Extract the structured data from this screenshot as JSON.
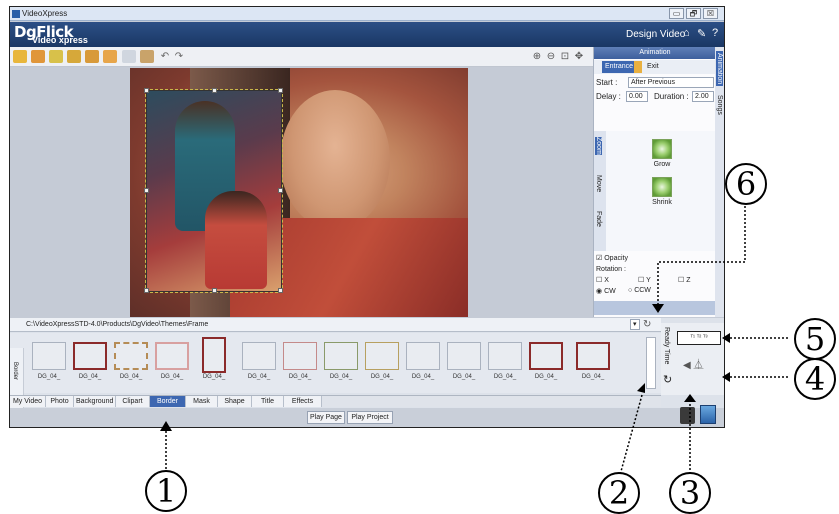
{
  "window": {
    "title": "VideoXpress",
    "controls": [
      "▭",
      "🗗",
      "☒"
    ]
  },
  "header": {
    "brand_top": "DgFlick",
    "brand_bottom": "Video xpress",
    "mode": "Design Video",
    "icons": [
      "home-icon",
      "wrench-icon",
      "help-icon"
    ],
    "help_glyph": "?"
  },
  "panel": {
    "title": "Animation",
    "tabs": [
      "Entrance",
      "Exit"
    ],
    "start_label": "Start :",
    "start_value": "After Previous",
    "delay_label": "Delay :",
    "delay_value": "0.00",
    "duration_label": "Duration :",
    "duration_value": "2.00",
    "side_tabs": [
      "Zoom",
      "Move",
      "Fade"
    ],
    "effects": [
      "Grow",
      "Shrink"
    ],
    "opacity_label": "Opacity",
    "rotation_label": "Rotation :",
    "axes": [
      "X",
      "Y",
      "Z"
    ],
    "dir": [
      "CW",
      "CCW"
    ],
    "right_tabs": [
      "Animation",
      "Songs"
    ]
  },
  "bottom": {
    "path": "C:\\VideoXpressSTD-4.0\\Products\\DgVideo\\Themes\\Frame",
    "side_label": "Border",
    "ready_time": "Ready Time",
    "thumb_labels": [
      "DG_04_",
      "DG_04_",
      "DG_04_",
      "DG_04_",
      "DG_04_",
      "DG_04_",
      "DG_04_",
      "DG_04_",
      "DG_04_",
      "DG_04_",
      "DG_04_",
      "DG_04_",
      "DG_04_",
      "DG_04_",
      "DG_04_"
    ],
    "tabs": [
      "My Video",
      "Photo",
      "Background",
      "Clipart",
      "Border",
      "Mask",
      "Shape",
      "Title",
      "Effects"
    ],
    "active_tab": "Border",
    "play_page": "Play Page",
    "play_project": "Play Project"
  },
  "callouts": [
    "1",
    "2",
    "3",
    "4",
    "5",
    "6"
  ]
}
